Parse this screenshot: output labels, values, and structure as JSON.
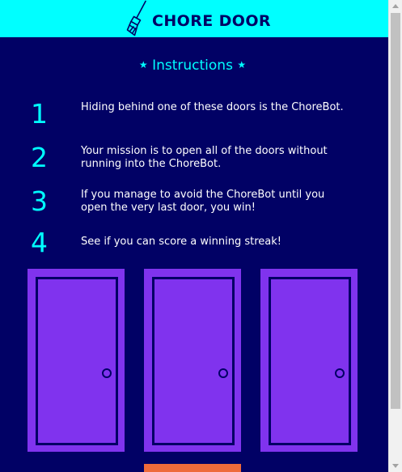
{
  "header": {
    "title": "CHORE DOOR",
    "logo_icon": "broom-icon",
    "background": "#00ffff"
  },
  "instructions": {
    "heading": "Instructions",
    "star_glyph": "★",
    "steps": [
      {
        "number": "1",
        "text": "Hiding behind one of these doors is the ChoreBot."
      },
      {
        "number": "2",
        "text": "Your mission is to open all of the doors without running into the ChoreBot."
      },
      {
        "number": "3",
        "text": "If you manage to avoid the ChoreBot until you open the very last door, you win!"
      },
      {
        "number": "4",
        "text": "See if you can score a winning streak!"
      }
    ]
  },
  "doors": [
    {
      "name": "door-1"
    },
    {
      "name": "door-2"
    },
    {
      "name": "door-3"
    }
  ],
  "colors": {
    "page_background": "#010165",
    "accent": "#00ffff",
    "door": "#8033ee",
    "start_button": "#ee6a3a",
    "text": "#ffffff"
  }
}
